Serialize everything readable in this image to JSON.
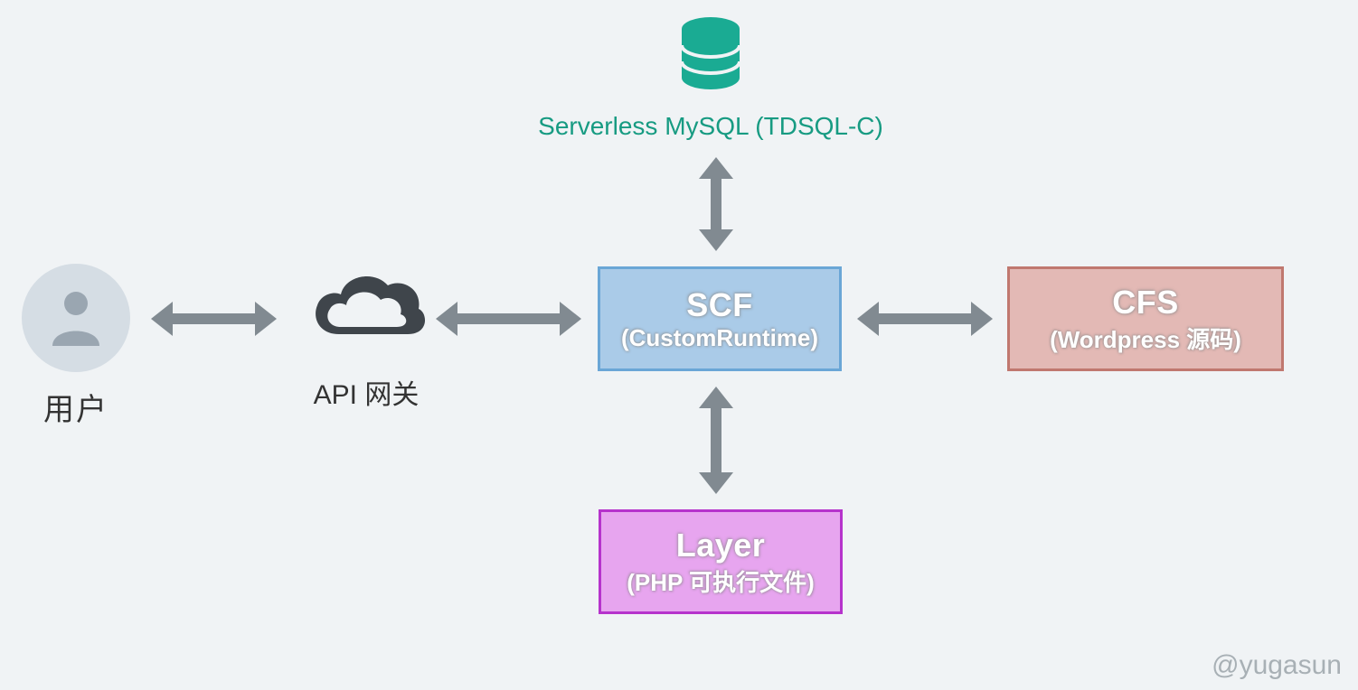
{
  "nodes": {
    "user": {
      "label": "用户"
    },
    "api": {
      "label": "API 网关"
    },
    "db": {
      "label": "Serverless MySQL (TDSQL-C)"
    },
    "scf": {
      "title": "SCF",
      "sub": "(CustomRuntime)"
    },
    "layer": {
      "title": "Layer",
      "sub": "(PHP 可执行文件)"
    },
    "cfs": {
      "title": "CFS",
      "sub": "(Wordpress 源码)"
    }
  },
  "colors": {
    "arrow": "#818a91",
    "db": "#179b82",
    "scf_fill": "#aacbe8",
    "scf_border": "#6aa6d6",
    "layer_fill": "#e7a5ef",
    "layer_border": "#b633cc",
    "cfs_fill": "#e3b9b5",
    "cfs_border": "#c0786f"
  },
  "watermark": "@yugasun"
}
